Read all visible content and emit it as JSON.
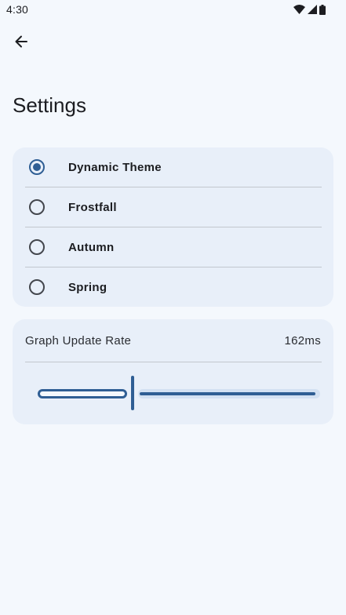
{
  "status_bar": {
    "time": "4:30",
    "icons": [
      "wifi-icon",
      "signal-icon",
      "battery-icon"
    ]
  },
  "header": {
    "back_icon": "arrow-back-icon",
    "title": "Settings"
  },
  "themes": {
    "selected": "Dynamic Theme",
    "options": [
      {
        "label": "Dynamic Theme",
        "selected": true
      },
      {
        "label": "Frostfall",
        "selected": false
      },
      {
        "label": "Autumn",
        "selected": false
      },
      {
        "label": "Spring",
        "selected": false
      }
    ]
  },
  "graph_update_rate": {
    "label": "Graph Update Rate",
    "value_text": "162ms",
    "slider_fraction": 0.33
  },
  "colors": {
    "accent": "#2f5e94",
    "background": "#f4f8fd",
    "card": "#e8eff9",
    "track_inactive": "#d3e1f2"
  }
}
